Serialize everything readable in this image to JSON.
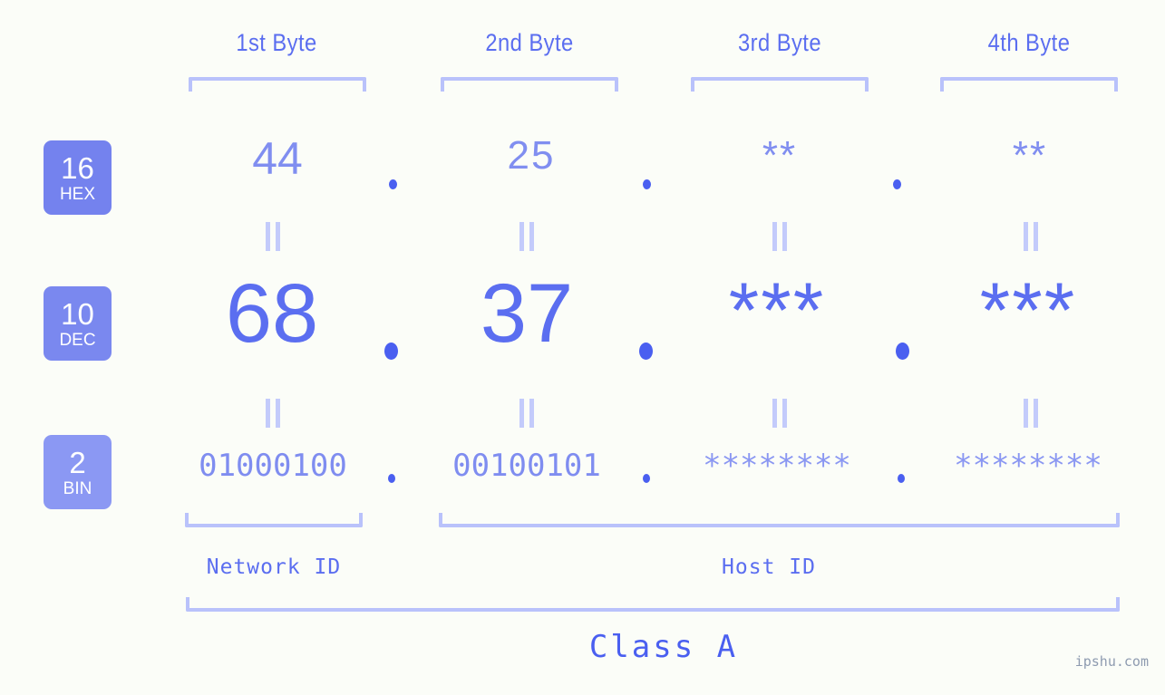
{
  "meta": {
    "background_color": "#fbfdf8",
    "accent_color": "#5b6ef0",
    "accent_light_color": "#b9c2fb",
    "badge_color": "#7482ee",
    "watermark": "ipshu.com"
  },
  "byte_headers": [
    {
      "label": "1st Byte"
    },
    {
      "label": "2nd Byte"
    },
    {
      "label": "3rd Byte"
    },
    {
      "label": "4th Byte"
    }
  ],
  "rows": [
    {
      "radix": "16",
      "radix_name": "HEX",
      "values": [
        "44",
        "25",
        "**",
        "**"
      ],
      "separator": "."
    },
    {
      "radix": "10",
      "radix_name": "DEC",
      "values": [
        "68",
        "37",
        "***",
        "***"
      ],
      "separator": "."
    },
    {
      "radix": "2",
      "radix_name": "BIN",
      "values": [
        "01000100",
        "00100101",
        "********",
        "********"
      ],
      "separator": "."
    }
  ],
  "regions": [
    {
      "label": "Network ID"
    },
    {
      "label": "Host ID"
    }
  ],
  "class": {
    "label": "Class A"
  }
}
